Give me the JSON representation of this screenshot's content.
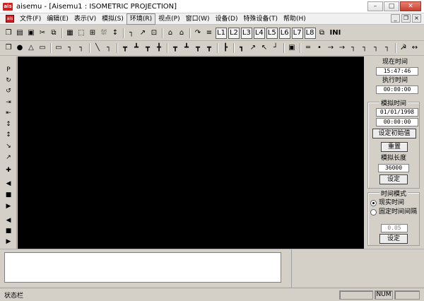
{
  "window": {
    "app_name": "aisemu",
    "title": "aisemu - [Aisemu1 : ISOMETRIC PROJECTION]",
    "logo_text": "ais",
    "min": "–",
    "max": "□",
    "close": "✕"
  },
  "menu": {
    "doc_icon_text": "ais",
    "items": [
      {
        "label": "文件(F)"
      },
      {
        "label": "编辑(E)"
      },
      {
        "label": "表示(V)"
      },
      {
        "label": "模拟(S)"
      },
      {
        "label": "环境(R)"
      },
      {
        "label": "视点(P)"
      },
      {
        "label": "窗口(W)"
      },
      {
        "label": "设备(D)"
      },
      {
        "label": "特殊设备(T)"
      },
      {
        "label": "帮助(H)"
      }
    ],
    "mdi_min": "_",
    "mdi_restore": "❐",
    "mdi_close": "×"
  },
  "toolbar1": {
    "glyphs": [
      "❐",
      "▤",
      "▣",
      "✂",
      "⧉",
      "▦",
      "⬚",
      "⊞",
      "⛆",
      "↕",
      "┐",
      "↗",
      "⊡",
      "⌂",
      "⌂",
      "↷",
      "≡"
    ],
    "layers": [
      "L1",
      "L2",
      "L3",
      "L4",
      "L5",
      "L6",
      "L7",
      "L8"
    ],
    "tail_glyph": "⧉",
    "ini_label": "INI"
  },
  "toolbar2": {
    "glyphs": [
      "❐",
      "●",
      "△",
      "▭",
      "▭",
      "┐",
      "┐",
      "╲",
      "┐",
      "┳",
      "┻",
      "┳",
      "╋",
      "┳",
      "┻",
      "┳",
      "┳",
      "┣",
      "┓",
      "↗",
      "↖",
      "┘",
      "▣",
      "═",
      "•",
      "→",
      "→",
      "┐",
      "┐",
      "┐",
      "┐",
      "☭",
      "↔"
    ]
  },
  "left_tools": {
    "glyphs": [
      "P",
      "↻",
      "↺",
      "⇥",
      "⇤",
      "↕",
      "↕",
      "↘",
      "↗",
      "✚",
      "◀",
      "■",
      "▶",
      "◀",
      "■",
      "▶"
    ]
  },
  "panel": {
    "current_time_label": "现在时间",
    "current_time": "15:47:46",
    "exec_time_label": "执行时间",
    "exec_time": "00:00:00",
    "sim_group_title": "模拟时间",
    "sim_date": "01/01/1998",
    "sim_time": "00:00:00",
    "init_button": "设定初始值",
    "reset_button": "重置",
    "sim_length_label": "模拟长度",
    "sim_length_value": "36000",
    "set_button": "设定",
    "mode_group_title": "时间模式",
    "mode_realtime": "现实时间",
    "mode_fixed": "固定时间间隔",
    "interval_value": "0.05",
    "interval_set_button": "设定"
  },
  "statusbar": {
    "text": "状态栏",
    "num": "NUM"
  }
}
